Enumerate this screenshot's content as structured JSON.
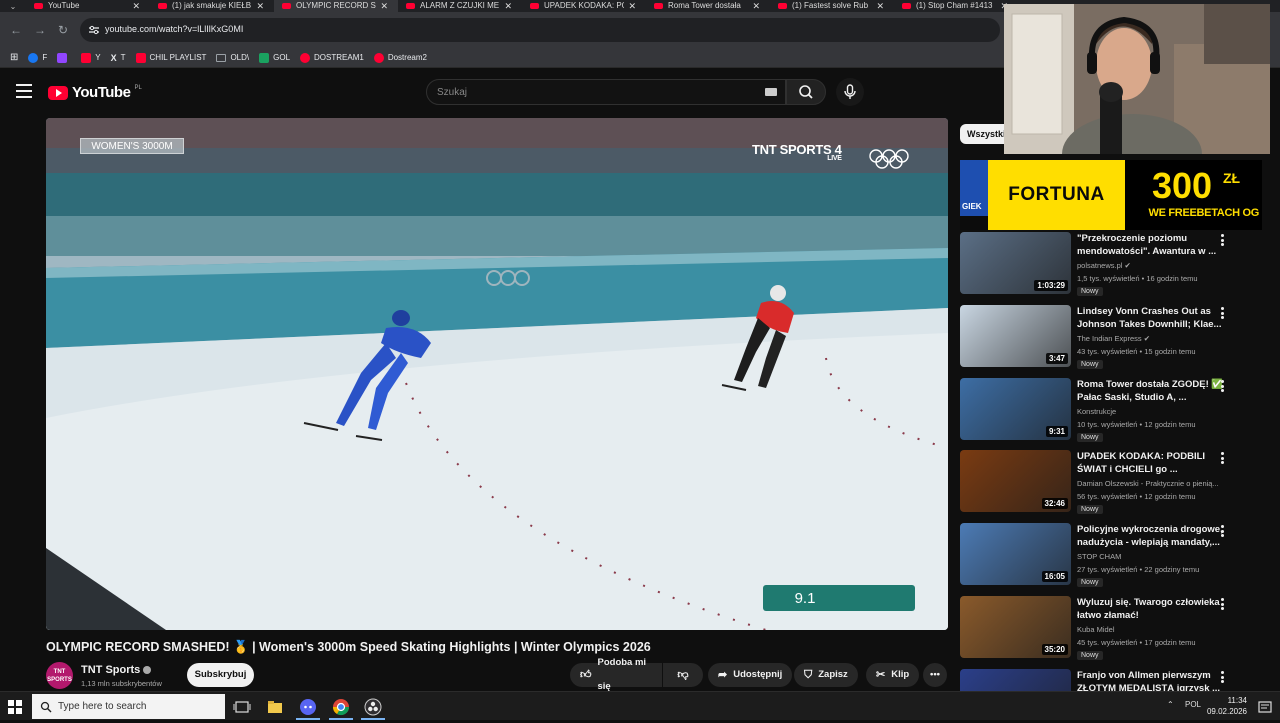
{
  "browser": {
    "tabs": [
      {
        "title": "YouTube",
        "active": false
      },
      {
        "title": "(1) jak smakuje KIEŁB",
        "active": false
      },
      {
        "title": "OLYMPIC RECORD SM",
        "active": true
      },
      {
        "title": "ALARM Z CZUJKI ME",
        "active": false
      },
      {
        "title": "UPADEK KODAKA: PO",
        "active": false
      },
      {
        "title": "Roma Tower dostała",
        "active": false
      },
      {
        "title": "(1) Fastest solve Rub",
        "active": false
      },
      {
        "title": "(1) Stop Cham #1413",
        "active": false
      }
    ],
    "url": "youtube.com/watch?v=lLlIlKxG0MI",
    "bookmarks": [
      {
        "label": "F",
        "color": "#1877f2"
      },
      {
        "label": "",
        "color": "#9146ff"
      },
      {
        "label": "Y",
        "color": "#ff0033"
      },
      {
        "label": "T",
        "color": "#e8eaed"
      },
      {
        "label": "CHIL PLAYLIST",
        "color": "#ff0033"
      },
      {
        "label": "OLD\\",
        "color": "#9aa0a6"
      },
      {
        "label": "GOL",
        "color": "#1aa260"
      },
      {
        "label": "DOSTREAM1",
        "color": "#ff0033"
      },
      {
        "label": "Dostream2",
        "color": "#ff0033"
      }
    ]
  },
  "youtube": {
    "logo_text": "YouTube",
    "country_code": "PL",
    "search_placeholder": "Szukaj",
    "chip_all": "Wszystki"
  },
  "video": {
    "overlay_event": "WOMEN'S 3000M",
    "broadcaster": "TNT SPORTS 4",
    "broadcaster_live": "LIVE",
    "score_value": "9.1",
    "title": "OLYMPIC RECORD SMASHED! 🥇 | Women's 3000m Speed Skating Highlights | Winter Olympics 2026",
    "channel_name": "TNT Sports",
    "channel_avatar_text": "TNT SPORTS",
    "subscribers": "1,13 mln subskrybentów",
    "subscribe_label": "Subskrybuj",
    "actions": {
      "like": "Podoba mi się",
      "share": "Udostępnij",
      "save": "Zapisz",
      "clip": "Klip"
    }
  },
  "ad": {
    "left_text": "GIEK",
    "brand": "FORTUNA",
    "amount": "300",
    "currency": "ZŁ",
    "tagline": "WE FREEBETACH OG"
  },
  "recommendations": [
    {
      "title": "\"Przekroczenie poziomu mendowatości\". Awantura w ...",
      "channel": "polsatnews.pl",
      "verified": true,
      "meta": "1,5 tys. wyświetleń • 16 godzin temu",
      "badge": "Nowy",
      "duration": "1:03:29",
      "thumb_color": "#5b6f86"
    },
    {
      "title": "Lindsey Vonn Crashes Out as Johnson Takes Downhill; Klae...",
      "channel": "The Indian Express",
      "verified": true,
      "meta": "43 tys. wyświetleń • 15 godzin temu",
      "badge": "Nowy",
      "duration": "3:47",
      "thumb_color": "#c9d6e2"
    },
    {
      "title": "Roma Tower dostała ZGODĘ! ✅ Pałac Saski, Studio A, ...",
      "channel": "Konstrukcje",
      "verified": false,
      "meta": "10 tys. wyświetleń • 12 godzin temu",
      "badge": "Nowy",
      "duration": "9:31",
      "thumb_color": "#3d6ea5"
    },
    {
      "title": "UPADEK KODAKA: PODBILI ŚWIAT i CHCIELI go ...",
      "channel": "Damian Olszewski - Praktycznie o pienią...",
      "verified": false,
      "meta": "56 tys. wyświetleń • 12 godzin temu",
      "badge": "Nowy",
      "duration": "32:46",
      "thumb_color": "#7a3b12"
    },
    {
      "title": "Policyjne wykroczenia drogowe, nadużycia - wlepiają mandaty,...",
      "channel": "STOP CHAM",
      "verified": false,
      "meta": "27 tys. wyświetleń • 22 godziny temu",
      "badge": "Nowy",
      "duration": "16:05",
      "thumb_color": "#4c7bb5"
    },
    {
      "title": "Wyluzuj się. Twarogo człowieka łatwo złamać!",
      "channel": "Kuba Midel",
      "verified": false,
      "meta": "45 tys. wyświetleń • 17 godzin temu",
      "badge": "Nowy",
      "duration": "35:20",
      "thumb_color": "#8a5a2b"
    },
    {
      "title": "Franjo von Allmen pierwszym ZŁOTYM MEDALISTĄ igrzysk ...",
      "channel": "",
      "verified": false,
      "meta": "",
      "badge": "",
      "duration": "",
      "thumb_color": "#2b3f8a"
    }
  ],
  "taskbar": {
    "search_placeholder": "Type here to search",
    "language": "POL",
    "time": "11:34",
    "date": "09.02.2026"
  }
}
